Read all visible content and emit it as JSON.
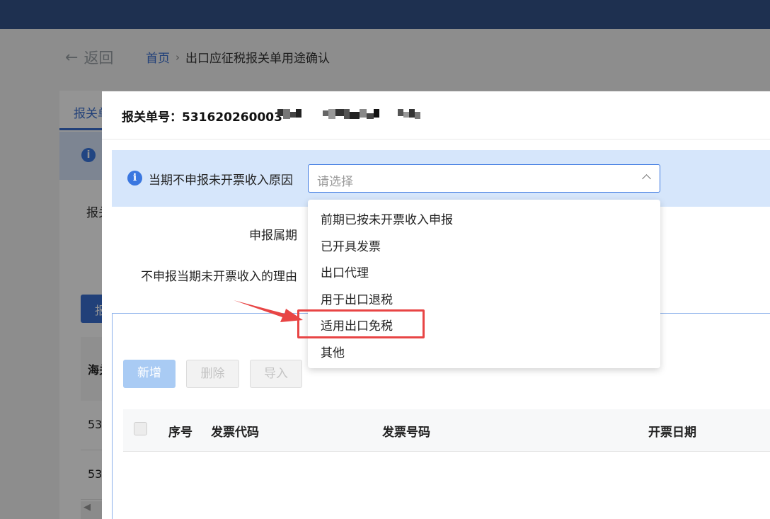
{
  "background": {
    "back_label": "返回",
    "breadcrumb": {
      "home": "首页",
      "separator": "›",
      "current": "出口应征税报关单用途确认"
    },
    "tab_label": "报关单",
    "info_icon_glyph": "i",
    "label_fragment": "报关单",
    "button_fragment": "报",
    "table_header_fragment": "海关",
    "row_values": [
      "53",
      "53"
    ],
    "scroll_arrow": "◀"
  },
  "modal": {
    "declaration_label": "报关单号：",
    "declaration_number_visible": "531620260003",
    "info_icon_glyph": "i",
    "reason_label": "当期不申报未开票收入原因",
    "reason_placeholder": "请选择",
    "period_label": "申报属期",
    "no_declare_reason_label": "不申报当期未开票收入的理由",
    "buttons": {
      "add": "新增",
      "delete": "删除",
      "import": "导入"
    },
    "table_headers": {
      "seq": "序号",
      "invoice_code": "发票代码",
      "invoice_number": "发票号码",
      "invoice_date": "开票日期"
    }
  },
  "dropdown": {
    "options": [
      "前期已按未开票收入申报",
      "已开具发票",
      "出口代理",
      "用于出口退税",
      "适用出口免税",
      "其他"
    ],
    "highlighted_index": 4
  },
  "colors": {
    "topbar": "#34548a",
    "primary": "#3a77e0",
    "info_bar": "#d6e6fb",
    "annotation": "#e84545"
  }
}
